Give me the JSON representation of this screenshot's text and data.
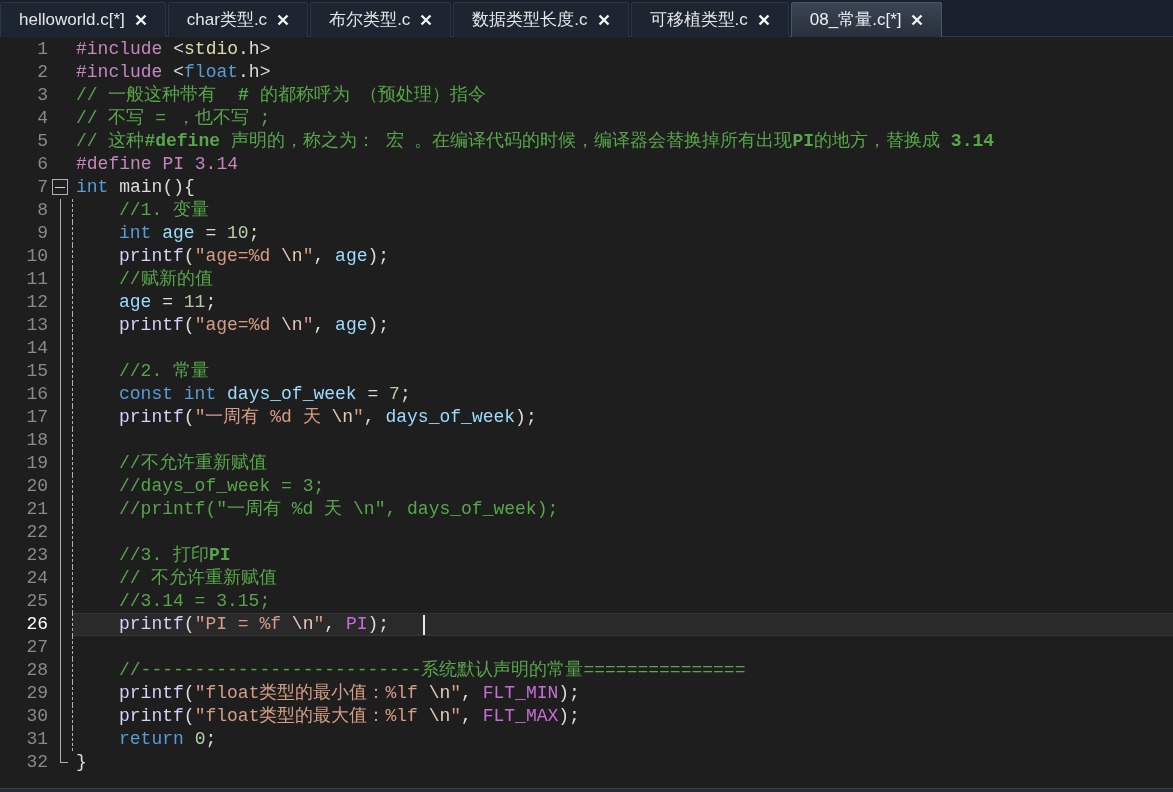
{
  "tabs": [
    {
      "label": "helloworld.c[*]",
      "selected": false
    },
    {
      "label": "char类型.c",
      "selected": false
    },
    {
      "label": "布尔类型.c",
      "selected": false
    },
    {
      "label": "数据类型长度.c",
      "selected": false
    },
    {
      "label": "可移植类型.c",
      "selected": false
    },
    {
      "label": "08_常量.c[*]",
      "selected": true
    }
  ],
  "lines": [
    {
      "number": "1",
      "current": false,
      "tokens": [
        {
          "kind": "pre",
          "text": "#include"
        },
        {
          "kind": "punct",
          "text": " <"
        },
        {
          "kind": "header",
          "text": "stdio"
        },
        {
          "kind": "punct",
          "text": ".h>"
        }
      ]
    },
    {
      "number": "2",
      "current": false,
      "tokens": [
        {
          "kind": "pre",
          "text": "#include"
        },
        {
          "kind": "punct",
          "text": " <"
        },
        {
          "kind": "kw",
          "text": "float"
        },
        {
          "kind": "punct",
          "text": ".h>"
        }
      ]
    },
    {
      "number": "3",
      "current": false,
      "tokens": [
        {
          "kind": "comment",
          "text": "// 一般这种带有  **#** 的都称呼为 （预处理）指令"
        }
      ]
    },
    {
      "number": "4",
      "current": false,
      "tokens": [
        {
          "kind": "comment",
          "text": "// 不写 = ，也不写 ;"
        }
      ]
    },
    {
      "number": "5",
      "current": false,
      "tokens": [
        {
          "kind": "comment",
          "text": "// 这种**#define** 声明的，称之为： 宏 。在编译代码的时候，编译器会替换掉所有出现**PI**的地方，替换成 **3.14**"
        }
      ]
    },
    {
      "number": "6",
      "current": false,
      "tokens": [
        {
          "kind": "pre",
          "text": "#define PI 3.14"
        }
      ]
    },
    {
      "number": "7",
      "current": false,
      "expanded": true,
      "tokens": [
        {
          "kind": "kw",
          "text": "int"
        },
        {
          "kind": "punct",
          "text": " main(){"
        }
      ],
      "children": [
        {
          "number": "8",
          "current": false,
          "tokens": [
            {
              "kind": "comment",
              "text": "//1. 变量"
            }
          ]
        },
        {
          "number": "9",
          "current": false,
          "tokens": [
            {
              "kind": "kw",
              "text": "int "
            },
            {
              "kind": "var",
              "text": "age"
            },
            {
              "kind": "punct",
              "text": " = "
            },
            {
              "kind": "num",
              "text": "10"
            },
            {
              "kind": "punct",
              "text": ";"
            }
          ]
        },
        {
          "number": "10",
          "current": false,
          "tokens": [
            {
              "kind": "fn",
              "text": "printf"
            },
            {
              "kind": "punct",
              "text": "("
            },
            {
              "kind": "str",
              "text": "\"age=%d "
            },
            {
              "kind": "esc",
              "text": "\\n"
            },
            {
              "kind": "str",
              "text": "\""
            },
            {
              "kind": "punct",
              "text": ", "
            },
            {
              "kind": "var",
              "text": "age"
            },
            {
              "kind": "punct",
              "text": ");"
            }
          ]
        },
        {
          "number": "11",
          "current": false,
          "tokens": [
            {
              "kind": "comment",
              "text": "//赋新的值"
            }
          ]
        },
        {
          "number": "12",
          "current": false,
          "tokens": [
            {
              "kind": "var",
              "text": "age"
            },
            {
              "kind": "punct",
              "text": " = "
            },
            {
              "kind": "num",
              "text": "11"
            },
            {
              "kind": "punct",
              "text": ";"
            }
          ]
        },
        {
          "number": "13",
          "current": false,
          "tokens": [
            {
              "kind": "fn",
              "text": "printf"
            },
            {
              "kind": "punct",
              "text": "("
            },
            {
              "kind": "str",
              "text": "\"age=%d "
            },
            {
              "kind": "esc",
              "text": "\\n"
            },
            {
              "kind": "str",
              "text": "\""
            },
            {
              "kind": "punct",
              "text": ", "
            },
            {
              "kind": "var",
              "text": "age"
            },
            {
              "kind": "punct",
              "text": ");"
            }
          ]
        },
        {
          "number": "14",
          "current": false
        },
        {
          "number": "15",
          "current": false,
          "tokens": [
            {
              "kind": "comment",
              "text": "//2. 常量"
            }
          ]
        },
        {
          "number": "16",
          "current": false,
          "tokens": [
            {
              "kind": "kw",
              "text": "const "
            },
            {
              "kind": "kw",
              "text": "int "
            },
            {
              "kind": "var",
              "text": "days_of_week"
            },
            {
              "kind": "punct",
              "text": " = "
            },
            {
              "kind": "num",
              "text": "7"
            },
            {
              "kind": "punct",
              "text": ";"
            }
          ]
        },
        {
          "number": "17",
          "current": false,
          "tokens": [
            {
              "kind": "fn",
              "text": "printf"
            },
            {
              "kind": "punct",
              "text": "("
            },
            {
              "kind": "str",
              "text": "\"一周有 %d 天 "
            },
            {
              "kind": "esc",
              "text": "\\n"
            },
            {
              "kind": "str",
              "text": "\""
            },
            {
              "kind": "punct",
              "text": ", "
            },
            {
              "kind": "var",
              "text": "days_of_week"
            },
            {
              "kind": "punct",
              "text": ");"
            }
          ]
        },
        {
          "number": "18",
          "current": false
        },
        {
          "number": "19",
          "current": false,
          "tokens": [
            {
              "kind": "comment",
              "text": "//不允许重新赋值"
            }
          ]
        },
        {
          "number": "20",
          "current": false,
          "tokens": [
            {
              "kind": "comment",
              "text": "//days_of_week = 3;"
            }
          ]
        },
        {
          "number": "21",
          "current": false,
          "tokens": [
            {
              "kind": "comment",
              "text": "//printf(\"一周有 %d 天 \\n\", days_of_week);"
            }
          ]
        },
        {
          "number": "22",
          "current": false
        },
        {
          "number": "23",
          "current": false,
          "tokens": [
            {
              "kind": "comment",
              "text": "//3. 打印**PI**"
            }
          ]
        },
        {
          "number": "24",
          "current": false,
          "tokens": [
            {
              "kind": "comment",
              "text": "// 不允许重新赋值"
            }
          ]
        },
        {
          "number": "25",
          "current": false,
          "tokens": [
            {
              "kind": "comment",
              "text": "//3.14 = 3.15;"
            }
          ]
        },
        {
          "number": "26",
          "current": true,
          "tokens": [
            {
              "kind": "fn",
              "text": "printf"
            },
            {
              "kind": "punct",
              "text": "("
            },
            {
              "kind": "str",
              "text": "\"PI = %f "
            },
            {
              "kind": "esc",
              "text": "\\n"
            },
            {
              "kind": "str",
              "text": "\""
            },
            {
              "kind": "punct",
              "text": ", "
            },
            {
              "kind": "macro",
              "text": "PI"
            },
            {
              "kind": "punct",
              "text": ");"
            }
          ]
        },
        {
          "number": "27",
          "current": false
        },
        {
          "number": "28",
          "current": false,
          "tokens": [
            {
              "kind": "comment",
              "text": "//--------------------------系统默认声明的常量==============="
            }
          ]
        },
        {
          "number": "29",
          "current": false,
          "tokens": [
            {
              "kind": "fn",
              "text": "printf"
            },
            {
              "kind": "punct",
              "text": "("
            },
            {
              "kind": "str",
              "text": "\"float类型的最小值：%lf "
            },
            {
              "kind": "esc",
              "text": "\\n"
            },
            {
              "kind": "str",
              "text": "\""
            },
            {
              "kind": "punct",
              "text": ", "
            },
            {
              "kind": "macro",
              "text": "FLT_MIN"
            },
            {
              "kind": "punct",
              "text": ");"
            }
          ]
        },
        {
          "number": "30",
          "current": false,
          "tokens": [
            {
              "kind": "fn",
              "text": "printf"
            },
            {
              "kind": "punct",
              "text": "("
            },
            {
              "kind": "str",
              "text": "\"float类型的最大值：%lf "
            },
            {
              "kind": "esc",
              "text": "\\n"
            },
            {
              "kind": "str",
              "text": "\""
            },
            {
              "kind": "punct",
              "text": ", "
            },
            {
              "kind": "macro",
              "text": "FLT_MAX"
            },
            {
              "kind": "punct",
              "text": ");"
            }
          ]
        },
        {
          "number": "31",
          "current": false,
          "tokens": [
            {
              "kind": "kw",
              "text": "return "
            },
            {
              "kind": "num",
              "text": "0"
            },
            {
              "kind": "punct",
              "text": ";"
            }
          ]
        }
      ]
    },
    {
      "number": "32",
      "current": false,
      "close": true,
      "tokens": [
        {
          "kind": "punct",
          "text": "}"
        }
      ]
    }
  ]
}
